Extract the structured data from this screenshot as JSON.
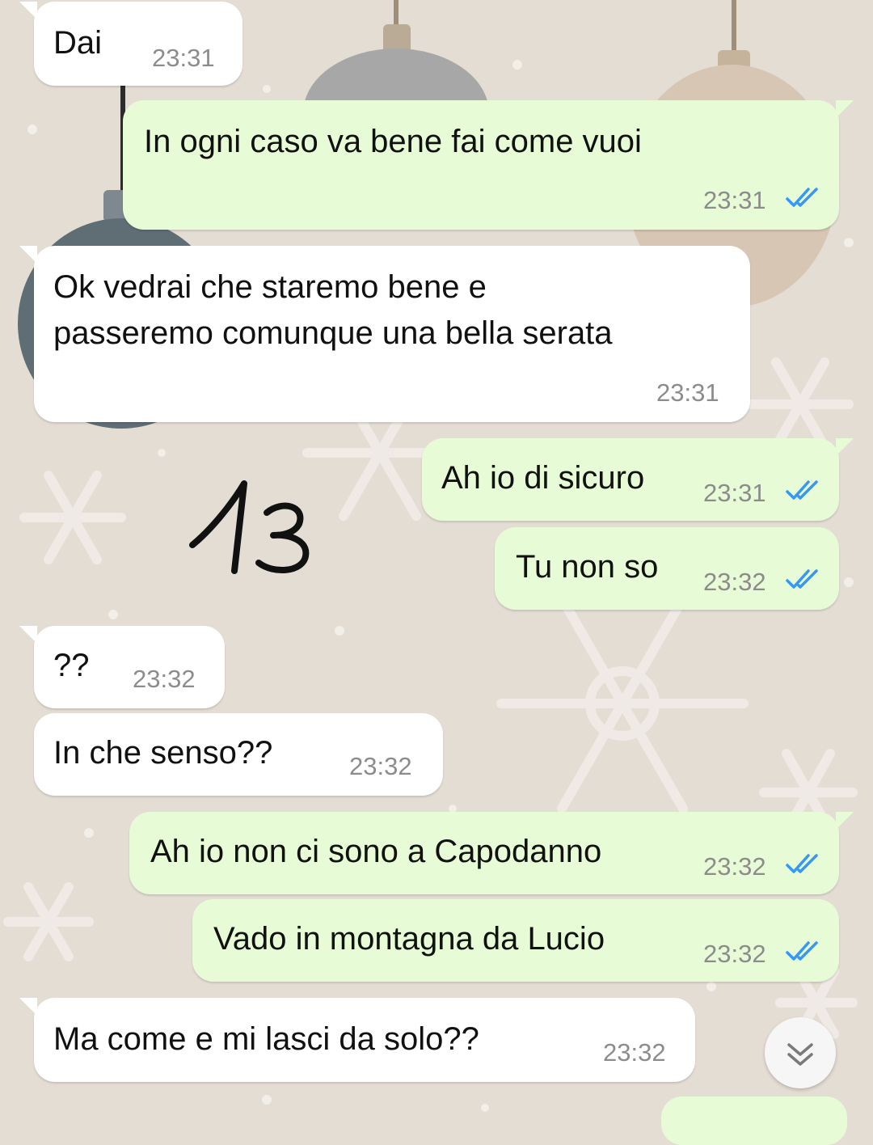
{
  "theme": {
    "incoming_bubble": "#ffffff",
    "outgoing_bubble": "#e7fcd6",
    "read_tick_color": "#3497f9",
    "time_color": "#8c8c8c",
    "text_color": "#111111"
  },
  "messages": [
    {
      "direction": "in",
      "lines": [
        "Dai"
      ],
      "time": "23:31"
    },
    {
      "direction": "out",
      "lines": [
        "In ogni caso va bene fai come vuoi"
      ],
      "time": "23:31",
      "status": "read"
    },
    {
      "direction": "in",
      "lines": [
        "Ok vedrai che staremo bene e",
        "passeremo comunque una bella serata"
      ],
      "time": "23:31"
    },
    {
      "direction": "out",
      "lines": [
        "Ah io di sicuro"
      ],
      "time": "23:31",
      "status": "read"
    },
    {
      "direction": "out",
      "lines": [
        "Tu non so"
      ],
      "time": "23:32",
      "status": "read"
    },
    {
      "direction": "in",
      "lines": [
        "??"
      ],
      "time": "23:32"
    },
    {
      "direction": "in",
      "lines": [
        "In che senso??"
      ],
      "time": "23:32"
    },
    {
      "direction": "out",
      "lines": [
        "Ah io non ci sono a Capodanno"
      ],
      "time": "23:32",
      "status": "read"
    },
    {
      "direction": "out",
      "lines": [
        "Vado in montagna da Lucio"
      ],
      "time": "23:32",
      "status": "read"
    },
    {
      "direction": "in",
      "lines": [
        "Ma come e mi lasci da solo??"
      ],
      "time": "23:32"
    }
  ],
  "annotation": {
    "text": "13",
    "icon": "handwritten-number"
  },
  "scroll_down_button": {
    "icon": "double-chevron-down-icon"
  }
}
